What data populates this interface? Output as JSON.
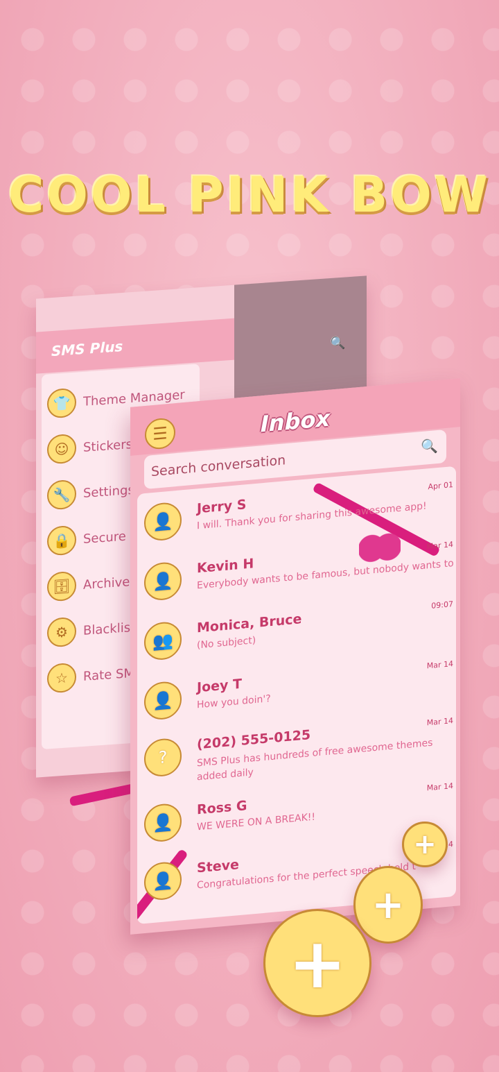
{
  "headline": "COOL PINK BOW",
  "drawer": {
    "app_title": "SMS Plus",
    "items": [
      {
        "label": "Theme Manager",
        "icon": "shirt-icon",
        "glyph": "👕"
      },
      {
        "label": "Stickers",
        "icon": "sticker-icon",
        "glyph": "☺"
      },
      {
        "label": "Settings",
        "icon": "wrench-icon",
        "glyph": "🔧"
      },
      {
        "label": "Secure",
        "icon": "lock-icon",
        "glyph": "🔒"
      },
      {
        "label": "Archive",
        "icon": "archive-icon",
        "glyph": "🗄"
      },
      {
        "label": "Blacklis",
        "icon": "blacklist-icon",
        "glyph": "⚙"
      },
      {
        "label": "Rate SM",
        "icon": "star-icon",
        "glyph": "☆"
      }
    ]
  },
  "inbox": {
    "title": "Inbox",
    "menu_glyph": "☰",
    "search_placeholder": "Search conversation",
    "search_glyph": "🔍",
    "conversations": [
      {
        "name": "Jerry S",
        "message": "I will. Thank you for sharing this awesome app!",
        "date": "Apr 01",
        "avatar": "single",
        "glyph": "👤"
      },
      {
        "name": "Kevin H",
        "message": "Everybody wants to be famous, but nobody wants to work",
        "date": "Mar 14",
        "avatar": "single",
        "glyph": "👤"
      },
      {
        "name": "Monica, Bruce",
        "message": "(No subject)",
        "date": "09:07",
        "avatar": "group",
        "glyph": "👥"
      },
      {
        "name": "Joey T",
        "message": "How you doin'?",
        "date": "Mar 14",
        "avatar": "single",
        "glyph": "👤"
      },
      {
        "name": "(202) 555-0125",
        "message": "SMS Plus has hundreds of free awesome themes added daily",
        "date": "Mar 14",
        "avatar": "unknown",
        "glyph": "?"
      },
      {
        "name": "Ross G",
        "message": "WE WERE ON A BREAK!!",
        "date": "Mar 14",
        "avatar": "single",
        "glyph": "👤"
      },
      {
        "name": "Steve",
        "message": "Congratulations for the perfect speech held t",
        "date": "Mar 14",
        "avatar": "single",
        "glyph": "👤"
      }
    ]
  },
  "fab": {
    "glyph": "+"
  },
  "colors": {
    "accent": "#c53a69",
    "ribbon": "#d91e7d",
    "button": "#ffe07a"
  }
}
